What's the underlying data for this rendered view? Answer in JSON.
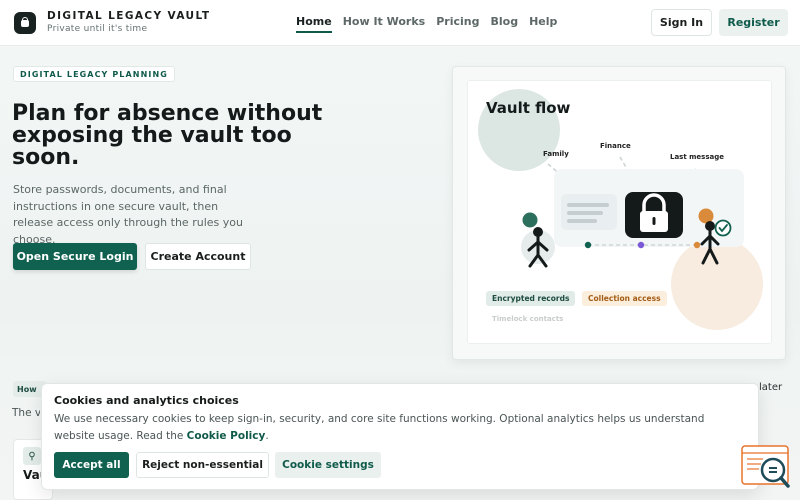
{
  "header": {
    "brand_name": "DIGITAL LEGACY VAULT",
    "brand_tagline": "Private until it's time",
    "nav": [
      {
        "label": "Home",
        "active": true
      },
      {
        "label": "How It Works",
        "active": false
      },
      {
        "label": "Pricing",
        "active": false
      },
      {
        "label": "Blog",
        "active": false
      },
      {
        "label": "Help",
        "active": false
      }
    ],
    "signin_label": "Sign In",
    "register_label": "Register"
  },
  "hero": {
    "eyebrow": "DIGITAL LEGACY PLANNING",
    "title": "Plan for absence without exposing the vault too soon.",
    "description": "Store passwords, documents, and final instructions in one secure vault, then release access only through the rules you choose.",
    "primary_cta": "Open Secure Login",
    "secondary_cta": "Create Account"
  },
  "vault_card": {
    "title": "Vault flow",
    "labels": {
      "family": "Family",
      "finance": "Finance",
      "last_message": "Last message"
    },
    "pills": {
      "encrypted": "Encrypted records",
      "collection": "Collection access"
    },
    "timelock": "Timelock contacts"
  },
  "background": {
    "how_tag": "How",
    "line_text": "The va",
    "later_text": "later",
    "card_title": "Vau"
  },
  "cookie_banner": {
    "title": "Cookies and analytics choices",
    "text": "We use necessary cookies to keep sign-in, security, and core site functions working. Optional analytics helps us understand website usage. Read the ",
    "policy_link": "Cookie Policy",
    "text_end": ".",
    "accept_label": "Accept all",
    "reject_label": "Reject non-essential",
    "settings_label": "Cookie settings"
  },
  "icons": {
    "brand": "lock-logo-icon",
    "vault": "padlock-icon",
    "help": "search-document-icon",
    "key": "key-icon"
  },
  "colors": {
    "primary": "#10614f",
    "accent_orange": "#d98a3a",
    "accent_purple": "#7a58d6"
  }
}
